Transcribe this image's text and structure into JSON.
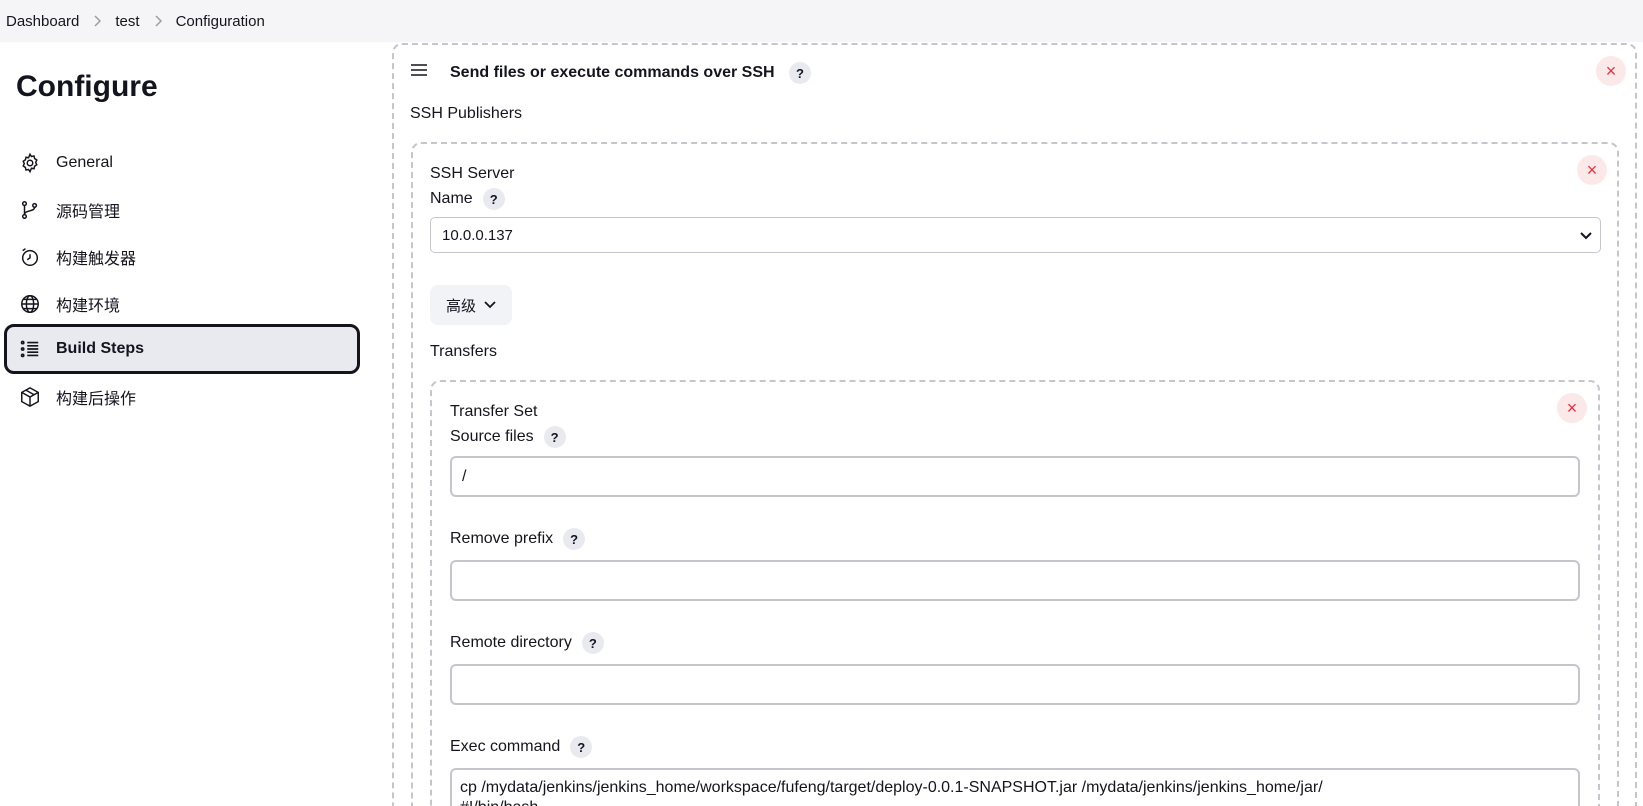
{
  "breadcrumb": [
    "Dashboard",
    "test",
    "Configuration"
  ],
  "page_title": "Configure",
  "sidebar": {
    "items": [
      {
        "label": "General",
        "icon": "gear-icon"
      },
      {
        "label": "源码管理",
        "icon": "branch-icon"
      },
      {
        "label": "构建触发器",
        "icon": "timer-icon"
      },
      {
        "label": "构建环境",
        "icon": "globe-icon"
      },
      {
        "label": "Build Steps",
        "icon": "list-icon",
        "active": true
      },
      {
        "label": "构建后操作",
        "icon": "package-icon"
      }
    ]
  },
  "section": {
    "title": "Send files or execute commands over SSH",
    "publishers_label": "SSH Publishers",
    "server": {
      "heading": "SSH Server",
      "name_label": "Name",
      "name_value": "10.0.0.137",
      "advanced_label": "高级",
      "transfers_label": "Transfers"
    },
    "transfer_set": {
      "heading": "Transfer Set",
      "source_files_label": "Source files",
      "source_files_value": "/",
      "remove_prefix_label": "Remove prefix",
      "remove_prefix_value": "",
      "remote_directory_label": "Remote directory",
      "remote_directory_value": "",
      "exec_command_label": "Exec command",
      "exec_command_value": "cp /mydata/jenkins/jenkins_home/workspace/fufeng/target/deploy-0.0.1-SNAPSHOT.jar /mydata/jenkins/jenkins_home/jar/\n#!/bin/bash"
    }
  },
  "help_glyph": "?",
  "close_glyph": "×",
  "colors": {
    "accent_dark": "#14141f",
    "close_red": "#e5333f",
    "active_bg": "#e9eaef"
  }
}
